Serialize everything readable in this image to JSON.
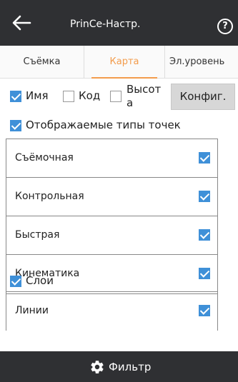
{
  "header": {
    "title": "PrinCe-Настр.",
    "back_icon": "arrow-left-icon",
    "help_icon": "help-circle-icon",
    "help_glyph": "?"
  },
  "tabs": [
    {
      "label": "Съёмка",
      "active": false
    },
    {
      "label": "Карта",
      "active": true
    },
    {
      "label": "Эл.уровень",
      "active": false
    }
  ],
  "options": {
    "name": {
      "label": "Имя",
      "checked": true
    },
    "code": {
      "label": "Код",
      "checked": false
    },
    "height": {
      "label": "Высот а",
      "line1": "Высот",
      "line2": "а",
      "checked": false
    },
    "config_label": "Конфиг."
  },
  "point_types": {
    "label": "Отображаемые типы точек",
    "checked": true,
    "items": [
      {
        "label": "Съёмочная",
        "checked": true
      },
      {
        "label": "Контрольная",
        "checked": true
      },
      {
        "label": "Быстрая",
        "checked": true
      },
      {
        "label": "Кинематика",
        "checked": true
      }
    ]
  },
  "layers": {
    "label": "Слои",
    "checked": true,
    "items": [
      {
        "label": "Линии",
        "checked": true
      }
    ]
  },
  "footer": {
    "filter_label": "Фильтр",
    "filter_icon": "gear-icon"
  },
  "colors": {
    "bar": "#2f3033",
    "accent": "#f39c4c",
    "checkbox": "#3f90d8"
  }
}
